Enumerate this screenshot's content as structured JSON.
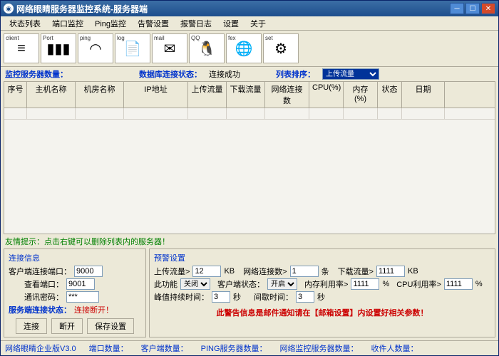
{
  "window": {
    "title": "网络眼睛服务器监控系统-服务器端"
  },
  "menu": [
    "状态列表",
    "端口监控",
    "Ping监控",
    "告警设置",
    "报警日志",
    "设置",
    "关于"
  ],
  "toolbar": [
    {
      "label": "client",
      "icon": "≡"
    },
    {
      "label": "Port",
      "icon": "▮▮▮"
    },
    {
      "label": "ping",
      "icon": "◠"
    },
    {
      "label": "log",
      "icon": "📄"
    },
    {
      "label": "mail",
      "icon": "✉"
    },
    {
      "label": "QQ",
      "icon": "🐧"
    },
    {
      "label": "fex",
      "icon": "🌐"
    },
    {
      "label": "set",
      "icon": "⚙"
    }
  ],
  "status": {
    "lbl_monitor": "监控服务器数量：",
    "lbl_db": "数据库连接状态：",
    "db_val": "连接成功",
    "lbl_sort": "列表排序：",
    "sort_val": "上传流量"
  },
  "grid_headers": [
    "序号",
    "主机名称",
    "机房名称",
    "IP地址",
    "上传流量",
    "下载流量",
    "网络连接数",
    "CPU(%)",
    "内存(%)",
    "状态",
    "日期"
  ],
  "hint": "友情提示：点击右键可以删除列表内的服务器！",
  "conn": {
    "title": "连接信息",
    "port_lbl": "客户端连接端口：",
    "port_val": "9000",
    "view_lbl": "查看端口：",
    "view_val": "9001",
    "pwd_lbl": "通讯密码：",
    "pwd_val": "***",
    "status_lbl": "服务端连接状态：",
    "status_val": "连接断开！",
    "btn_connect": "连接",
    "btn_disconnect": "断开",
    "btn_save": "保存设置"
  },
  "alarm": {
    "title": "预警设置",
    "up_lbl": "上传流量>",
    "up_val": "12",
    "kb": "KB",
    "conn_lbl": "网络连接数>",
    "conn_val": "1",
    "unit_item": "条",
    "down_lbl": "下载流量>",
    "down_val": "1111",
    "func_lbl": "此功能",
    "func_val": "关闭",
    "client_lbl": "客户端状态：",
    "client_val": "开启",
    "mem_lbl": "内存利用率>",
    "mem_val": "1111",
    "pct": "%",
    "cpu_lbl": "CPU利用率>",
    "cpu_val": "1111",
    "peak_lbl": "峰值持续时间：",
    "peak_val": "3",
    "sec": "秒",
    "gap_lbl": "间歇时间：",
    "gap_val": "3",
    "warn": "此警告信息是邮件通知请在【邮箱设置】内设置好相关参数！"
  },
  "footer": {
    "ver": "网络眼睛企业版V3.0",
    "f1": "端口数量：",
    "f2": "客户端数量：",
    "f3": "PING服务器数量：",
    "f4": "网络监控服务器数量：",
    "f5": "收件人数量："
  }
}
